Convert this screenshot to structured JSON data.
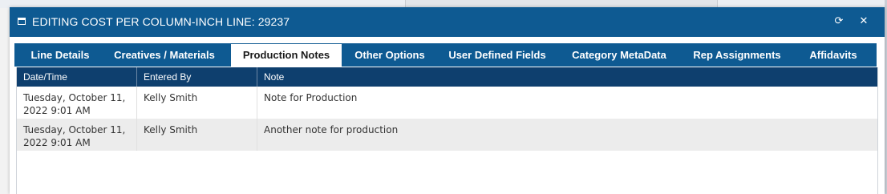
{
  "window": {
    "title": "EDITING COST PER COLUMN-INCH LINE: 29237",
    "refresh_icon": "refresh-icon",
    "close_icon": "close-icon",
    "refresh_glyph": "⟳",
    "close_glyph": "✕"
  },
  "tabs": [
    {
      "label": "Line Details",
      "active": false
    },
    {
      "label": "Creatives / Materials",
      "active": false
    },
    {
      "label": "Production Notes",
      "active": true
    },
    {
      "label": "Other Options",
      "active": false
    },
    {
      "label": "User Defined Fields",
      "active": false
    },
    {
      "label": "Category MetaData",
      "active": false
    },
    {
      "label": "Rep Assignments",
      "active": false
    },
    {
      "label": "Affidavits",
      "active": false
    }
  ],
  "grid": {
    "columns": [
      "Date/Time",
      "Entered By",
      "Note"
    ],
    "rows": [
      {
        "date_time": "Tuesday, October 11, 2022 9:01 AM",
        "entered_by": "Kelly Smith",
        "note": "Note for Production"
      },
      {
        "date_time": "Tuesday, October 11, 2022 9:01 AM",
        "entered_by": "Kelly Smith",
        "note": "Another note for production"
      }
    ]
  },
  "colors": {
    "titlebar": "#0e5a92",
    "grid_header": "#0e3f6e",
    "alt_row": "#ececec"
  }
}
